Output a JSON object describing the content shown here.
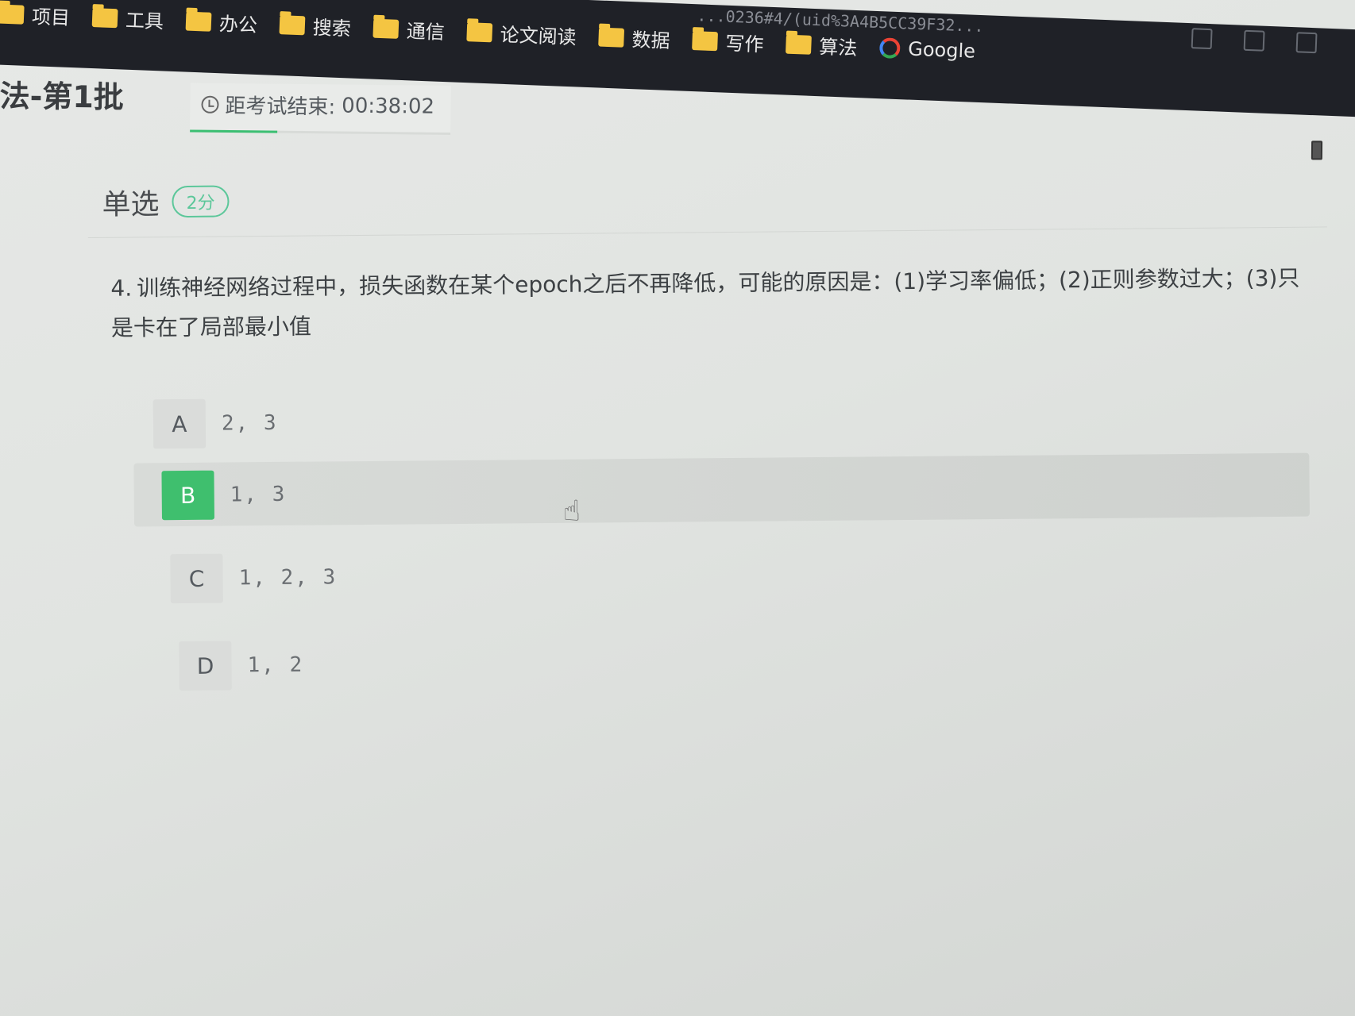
{
  "browser": {
    "url_fragment": "...0236#4/(uid%3A4B5CC39F32...",
    "bookmarks": [
      {
        "label": "项目",
        "icon": "folder-icon"
      },
      {
        "label": "工具",
        "icon": "folder-icon"
      },
      {
        "label": "办公",
        "icon": "folder-icon"
      },
      {
        "label": "搜索",
        "icon": "folder-icon"
      },
      {
        "label": "通信",
        "icon": "folder-icon"
      },
      {
        "label": "论文阅读",
        "icon": "folder-icon"
      },
      {
        "label": "数据",
        "icon": "folder-icon"
      },
      {
        "label": "写作",
        "icon": "folder-icon"
      },
      {
        "label": "算法",
        "icon": "folder-icon"
      },
      {
        "label": "Google",
        "icon": "google-icon"
      }
    ]
  },
  "header": {
    "title": "法-第1批",
    "timer_label": "距考试结束:",
    "timer_value": "00:38:02"
  },
  "question": {
    "type": "单选",
    "score": "2分",
    "number": "4.",
    "text": "训练神经网络过程中，损失函数在某个epoch之后不再降低，可能的原因是：(1)学习率偏低；(2)正则参数过大；(3)只是卡在了局部最小值",
    "options": [
      {
        "letter": "A",
        "text": "2, 3",
        "selected": false
      },
      {
        "letter": "B",
        "text": "1, 3",
        "selected": true
      },
      {
        "letter": "C",
        "text": "1, 2, 3",
        "selected": false
      },
      {
        "letter": "D",
        "text": "1, 2",
        "selected": false
      }
    ]
  },
  "colors": {
    "accent": "#3fbf6e",
    "badge": "#5cc79a",
    "chrome": "#1f2127"
  }
}
